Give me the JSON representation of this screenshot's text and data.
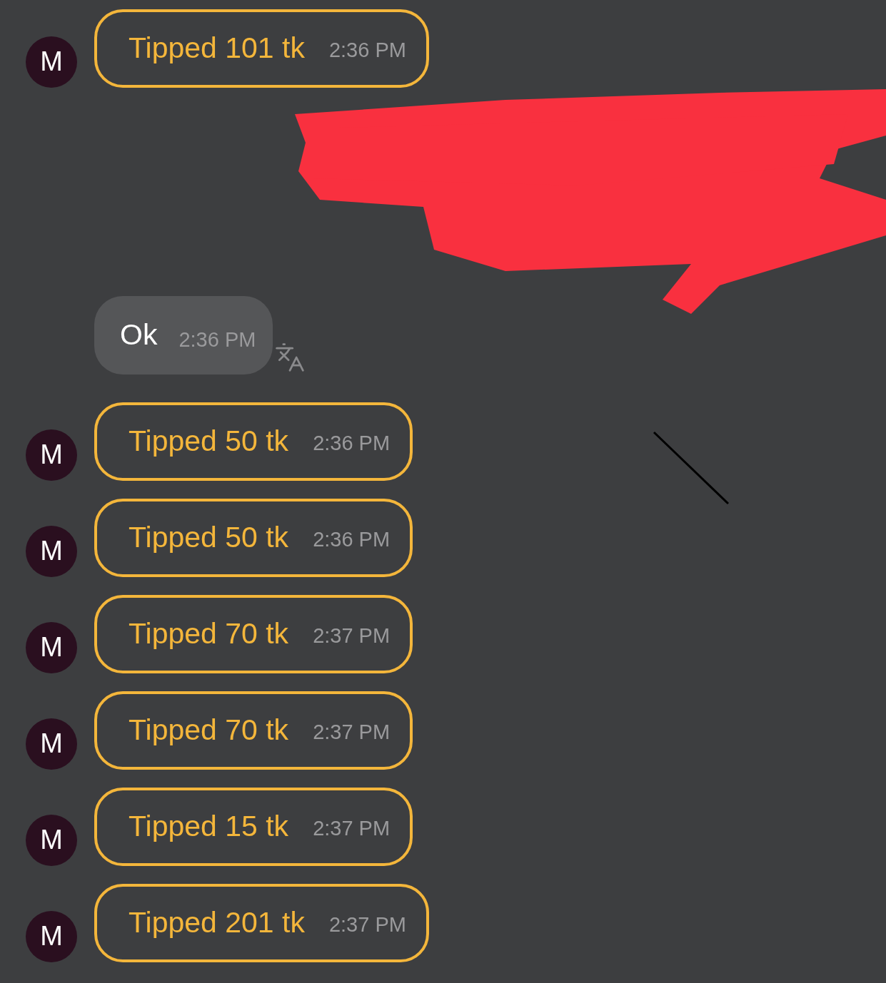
{
  "messages": [
    {
      "kind": "tip",
      "avatar": "M",
      "text": "Tipped 101 tk",
      "time": "2:36 PM"
    },
    {
      "kind": "redacted"
    },
    {
      "kind": "text",
      "text": "Ok",
      "time": "2:36 PM",
      "translate": true
    },
    {
      "kind": "tip",
      "avatar": "M",
      "text": "Tipped 50 tk",
      "time": "2:36 PM"
    },
    {
      "kind": "tip",
      "avatar": "M",
      "text": "Tipped 50 tk",
      "time": "2:36 PM"
    },
    {
      "kind": "tip",
      "avatar": "M",
      "text": "Tipped 70 tk",
      "time": "2:37 PM"
    },
    {
      "kind": "tip",
      "avatar": "M",
      "text": "Tipped 70 tk",
      "time": "2:37 PM"
    },
    {
      "kind": "tip",
      "avatar": "M",
      "text": "Tipped 15 tk",
      "time": "2:37 PM"
    },
    {
      "kind": "tip",
      "avatar": "M",
      "text": "Tipped 201 tk",
      "time": "2:37 PM"
    }
  ]
}
